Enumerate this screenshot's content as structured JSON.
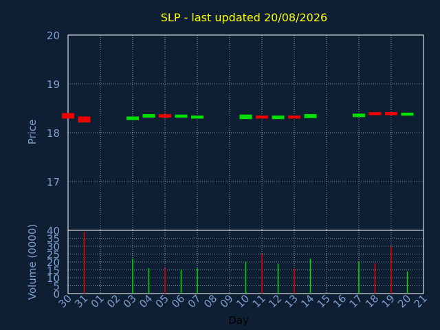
{
  "colors": {
    "background": "#0f1f33",
    "axis": "#ffffff",
    "grid": "#ffffff",
    "title": "#ffff00",
    "label": "#7f9fcf",
    "up": "#00e000",
    "down": "#ee0000"
  },
  "chart_data": [
    {
      "type": "candlestick",
      "title": "SLP - last updated 20/08/2026",
      "ylabel": "Price",
      "xlabel": "",
      "ylim": [
        16.0,
        20.0
      ],
      "yticks": [
        17,
        18,
        19,
        20
      ],
      "grid": true,
      "series": [
        {
          "day": "30",
          "open": 18.38,
          "close": 18.31,
          "dir": "down"
        },
        {
          "day": "31",
          "open": 18.31,
          "close": 18.23,
          "dir": "down"
        },
        {
          "day": "03",
          "open": 18.28,
          "close": 18.31,
          "dir": "up"
        },
        {
          "day": "04",
          "open": 18.33,
          "close": 18.36,
          "dir": "up"
        },
        {
          "day": "05",
          "open": 18.36,
          "close": 18.33,
          "dir": "down"
        },
        {
          "day": "06",
          "open": 18.33,
          "close": 18.35,
          "dir": "up"
        },
        {
          "day": "07",
          "open": 18.31,
          "close": 18.33,
          "dir": "up"
        },
        {
          "day": "10",
          "open": 18.3,
          "close": 18.35,
          "dir": "up"
        },
        {
          "day": "11",
          "open": 18.33,
          "close": 18.31,
          "dir": "down"
        },
        {
          "day": "12",
          "open": 18.3,
          "close": 18.33,
          "dir": "up"
        },
        {
          "day": "13",
          "open": 18.33,
          "close": 18.31,
          "dir": "down"
        },
        {
          "day": "14",
          "open": 18.32,
          "close": 18.36,
          "dir": "up"
        },
        {
          "day": "17",
          "open": 18.34,
          "close": 18.37,
          "dir": "up"
        },
        {
          "day": "18",
          "open": 18.4,
          "close": 18.38,
          "dir": "down"
        },
        {
          "day": "19",
          "open": 18.4,
          "close": 18.38,
          "dir": "down"
        },
        {
          "day": "20",
          "open": 18.37,
          "close": 18.39,
          "dir": "up"
        }
      ]
    },
    {
      "type": "bar",
      "title": "",
      "ylabel": "Volume (0000)",
      "xlabel": "Day",
      "ylim": [
        0,
        40
      ],
      "yticks": [
        0,
        5,
        10,
        15,
        20,
        25,
        30,
        35,
        40
      ],
      "grid": true,
      "categories": [
        "30",
        "31",
        "01",
        "02",
        "03",
        "04",
        "05",
        "06",
        "07",
        "08",
        "09",
        "10",
        "11",
        "12",
        "13",
        "14",
        "15",
        "16",
        "17",
        "18",
        "19",
        "20",
        "21"
      ],
      "series": [
        {
          "day": "31",
          "value": 39,
          "dir": "down"
        },
        {
          "day": "03",
          "value": 22,
          "dir": "up"
        },
        {
          "day": "04",
          "value": 16,
          "dir": "up"
        },
        {
          "day": "05",
          "value": 16,
          "dir": "down"
        },
        {
          "day": "06",
          "value": 15,
          "dir": "up"
        },
        {
          "day": "07",
          "value": 16,
          "dir": "up"
        },
        {
          "day": "10",
          "value": 20,
          "dir": "up"
        },
        {
          "day": "11",
          "value": 25,
          "dir": "down"
        },
        {
          "day": "12",
          "value": 19,
          "dir": "up"
        },
        {
          "day": "13",
          "value": 16,
          "dir": "down"
        },
        {
          "day": "14",
          "value": 22,
          "dir": "up"
        },
        {
          "day": "17",
          "value": 20,
          "dir": "up"
        },
        {
          "day": "18",
          "value": 19,
          "dir": "down"
        },
        {
          "day": "19",
          "value": 30,
          "dir": "down"
        },
        {
          "day": "20",
          "value": 14,
          "dir": "up"
        }
      ]
    }
  ]
}
